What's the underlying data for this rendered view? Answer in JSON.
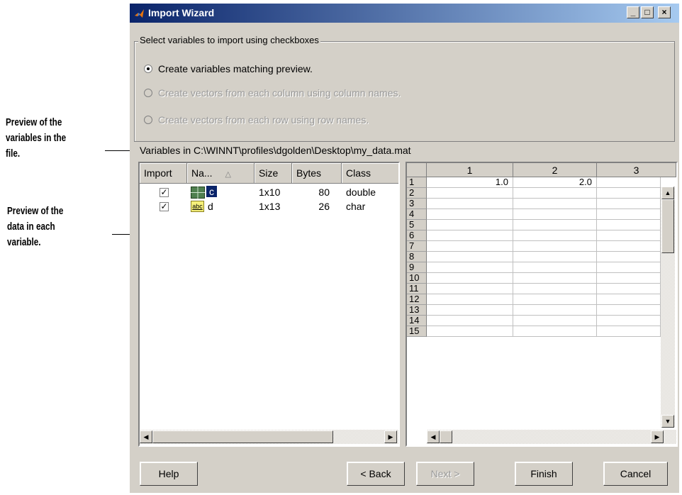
{
  "callouts": {
    "variables": "Preview of the variables in the file.",
    "variables_lines": [
      "Preview of the",
      "variables in the",
      "file."
    ],
    "data_lines": [
      "Preview of the",
      "data in each",
      "variable."
    ]
  },
  "window": {
    "title": "Import Wizard",
    "controls": {
      "minimize": "_",
      "maximize": "□",
      "close": "×"
    }
  },
  "options": {
    "group_label": "Select variables to import using checkboxes",
    "radios": [
      {
        "label": "Create variables matching preview.",
        "selected": true,
        "enabled": true
      },
      {
        "label": "Create vectors from each column using column names.",
        "selected": false,
        "enabled": false
      },
      {
        "label": "Create vectors from each row using row names.",
        "selected": false,
        "enabled": false
      }
    ]
  },
  "variables_path": "Variables in C:\\WINNT\\profiles\\dgolden\\Desktop\\my_data.mat",
  "variables_table": {
    "headers": [
      "Import",
      "Na...",
      "Size",
      "Bytes",
      "Class"
    ],
    "sort_indicator": "△",
    "rows": [
      {
        "checked": true,
        "icon": "matrix-icon",
        "name": "c",
        "size": "1x10",
        "bytes": "80",
        "class": "double"
      },
      {
        "checked": true,
        "icon": "abc-icon",
        "name": "d",
        "size": "1x13",
        "bytes": "26",
        "class": "char"
      }
    ],
    "abc_label": "abc"
  },
  "data_grid": {
    "columns": [
      "1",
      "2",
      "3"
    ],
    "rows": [
      "1",
      "2",
      "3",
      "4",
      "5",
      "6",
      "7",
      "8",
      "9",
      "10",
      "11",
      "12",
      "13",
      "14",
      "15"
    ],
    "values": [
      [
        "1.0",
        "2.0",
        ""
      ]
    ]
  },
  "buttons": {
    "help": "Help",
    "back": "< Back",
    "next": "Next >",
    "finish": "Finish",
    "cancel": "Cancel"
  }
}
